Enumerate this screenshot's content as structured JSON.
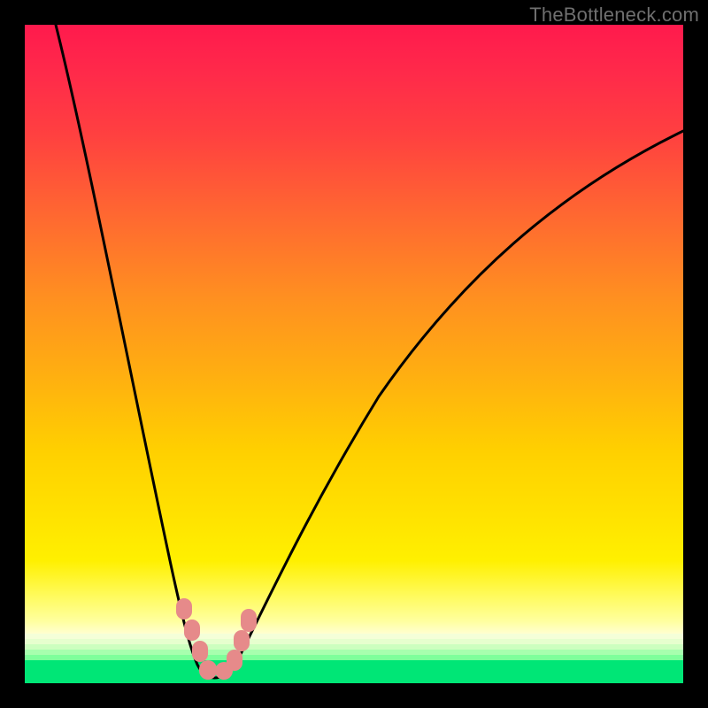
{
  "watermark": "TheBottleneck.com",
  "colors": {
    "frame": "#000000",
    "curve": "#000000",
    "marker": "#e68a8a",
    "green_band": "#00e676",
    "gradient_top": "#ff1a4d",
    "gradient_mid": "#ffd000",
    "gradient_bottom": "#ffffd0"
  },
  "chart_data": {
    "type": "line",
    "title": "",
    "xlabel": "",
    "ylabel": "",
    "xlim": [
      0,
      100
    ],
    "ylim": [
      0,
      100
    ],
    "description": "Bottleneck curve: V-shaped dip to ~0% near x≈27; rises steeply toward both sides. Background gradient red→orange→yellow encodes higher bottleneck, thin green band at the bottom encodes balanced region.",
    "series": [
      {
        "name": "bottleneck_percent",
        "x": [
          0,
          4,
          8,
          12,
          16,
          20,
          22,
          24,
          25,
          26,
          27,
          28,
          29,
          30,
          32,
          36,
          42,
          50,
          60,
          72,
          86,
          100
        ],
        "y": [
          100,
          88,
          75,
          62,
          48,
          30,
          20,
          10,
          5,
          2,
          0,
          0,
          2,
          4,
          8,
          15,
          25,
          38,
          52,
          65,
          77,
          84
        ]
      }
    ],
    "markers": [
      {
        "x": 24,
        "y": 8
      },
      {
        "x": 25,
        "y": 5
      },
      {
        "x": 26,
        "y": 2
      },
      {
        "x": 27,
        "y": 0
      },
      {
        "x": 28,
        "y": 0
      },
      {
        "x": 29,
        "y": 2
      },
      {
        "x": 30,
        "y": 4
      },
      {
        "x": 31,
        "y": 6
      }
    ],
    "background_zones": [
      {
        "name": "balanced",
        "y_range": [
          0,
          4
        ],
        "color": "#00e676"
      },
      {
        "name": "transition",
        "y_range": [
          4,
          8
        ],
        "color": "#ffffd0"
      },
      {
        "name": "bottleneck_gradient",
        "y_range": [
          8,
          100
        ],
        "color": "gradient red-yellow"
      }
    ]
  }
}
